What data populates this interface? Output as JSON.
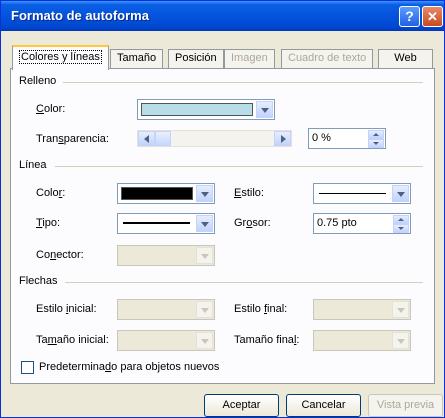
{
  "window": {
    "title": "Formato de autoforma",
    "help_glyph": "?",
    "close_glyph": "✕"
  },
  "tabs": [
    {
      "label": "Colores y líneas",
      "state": "active"
    },
    {
      "label": "Tamaño",
      "state": "enabled"
    },
    {
      "label": "Posición",
      "state": "enabled"
    },
    {
      "label": "Imagen",
      "state": "disabled"
    },
    {
      "label": "Cuadro de texto",
      "state": "disabled"
    },
    {
      "label": "Web",
      "state": "enabled"
    }
  ],
  "relleno": {
    "heading": "Relleno",
    "color_label_pre": "",
    "color_label_u": "C",
    "color_label_post": "olor:",
    "color_value": "#b7dde8",
    "transparencia_label_pre": "Tran",
    "transparencia_label_u": "s",
    "transparencia_label_post": "parencia:",
    "transparencia_value": "0 %"
  },
  "linea": {
    "heading": "Línea",
    "color_label_pre": "Colo",
    "color_label_u": "r",
    "color_label_post": ":",
    "color_value": "#000000",
    "estilo_label_pre": "",
    "estilo_label_u": "E",
    "estilo_label_post": "stilo:",
    "tipo_label_pre": "",
    "tipo_label_u": "T",
    "tipo_label_post": "ipo:",
    "grosor_label_pre": "Gr",
    "grosor_label_u": "o",
    "grosor_label_post": "sor:",
    "grosor_value": "0.75 pto",
    "conector_label_pre": "Co",
    "conector_label_u": "n",
    "conector_label_post": "ector:"
  },
  "flechas": {
    "heading": "Flechas",
    "estilo_inicial_pre": "Estilo ",
    "estilo_inicial_u": "i",
    "estilo_inicial_post": "nicial:",
    "estilo_final_pre": "Estilo ",
    "estilo_final_u": "f",
    "estilo_final_post": "inal:",
    "tamano_inicial_pre": "Ta",
    "tamano_inicial_u": "m",
    "tamano_inicial_post": "año inicial:",
    "tamano_final_pre": "Tamaño fina",
    "tamano_final_u": "l",
    "tamano_final_post": ":"
  },
  "default_checkbox": {
    "label_pre": "Predetermina",
    "label_u": "d",
    "label_post": "o para objetos nuevos",
    "checked": false
  },
  "buttons": {
    "accept": "Aceptar",
    "cancel": "Cancelar",
    "preview": "Vista previa"
  }
}
